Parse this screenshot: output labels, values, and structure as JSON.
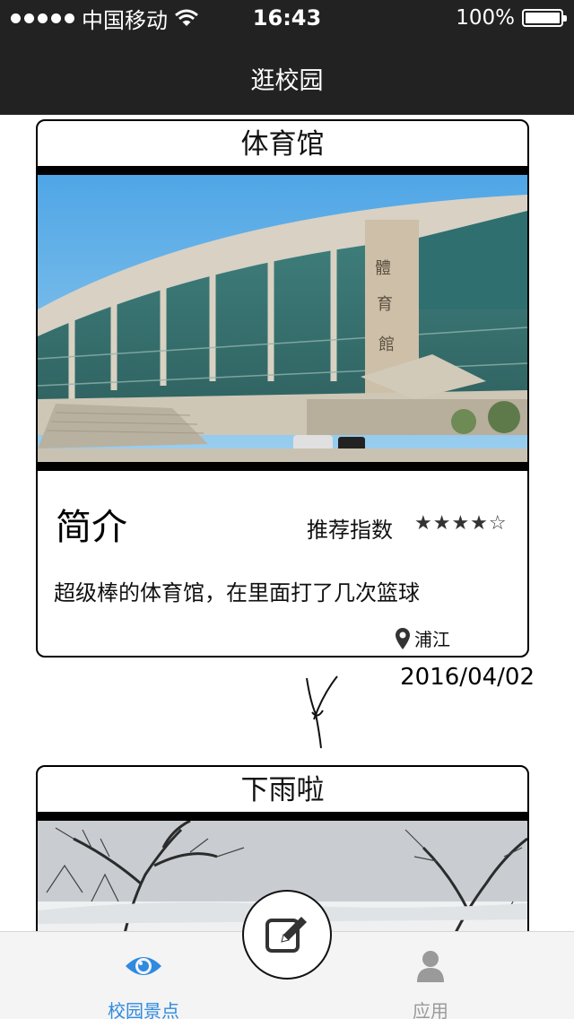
{
  "status_bar": {
    "carrier": "中国移动",
    "time": "16:43",
    "battery": "100%",
    "icons": [
      "signal-dots-icon",
      "wifi-icon",
      "battery-icon"
    ]
  },
  "nav": {
    "title": "逛校园"
  },
  "posts": [
    {
      "title": "体育馆",
      "intro_heading": "简介",
      "recommend_label": "推荐指数",
      "rating": 4,
      "rating_max": 5,
      "stars": "★★★★☆",
      "description": "超级棒的体育馆，在里面打了几次篮球",
      "location": "浦江",
      "date": "2016/04/02",
      "photo": "gymnasium-photo"
    },
    {
      "title": "下雨啦",
      "photo": "snowy-trees-photo"
    }
  ],
  "tab_bar": {
    "items": [
      {
        "label": "校园景点",
        "icon": "eye-icon",
        "active": true
      },
      {
        "label": "应用",
        "icon": "person-icon",
        "active": false
      }
    ],
    "center_button_icon": "edit-icon"
  },
  "colors": {
    "bar_background": "#222222",
    "active_tab": "#2f8ae0",
    "inactive_tab": "#9a9a9a"
  }
}
